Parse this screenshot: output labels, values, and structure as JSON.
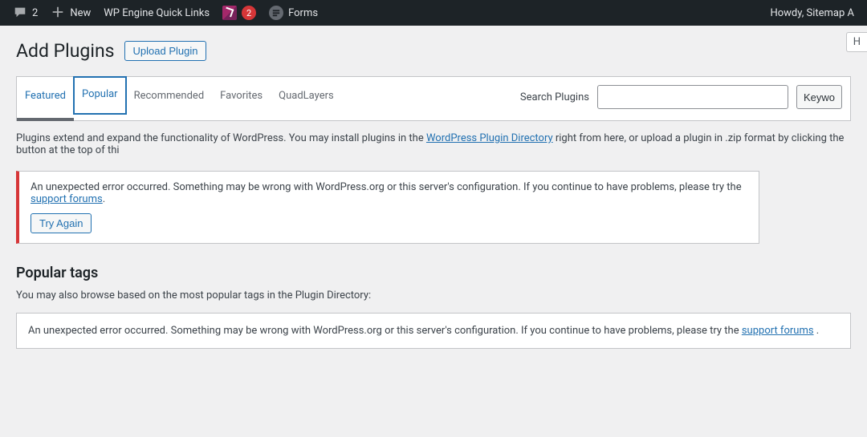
{
  "adminbar": {
    "comments_count": "2",
    "new_label": "New",
    "wpengine_label": "WP Engine Quick Links",
    "yoast_badge": "2",
    "forms_label": "Forms",
    "howdy": "Howdy, Sitemap A"
  },
  "help_tab": "H",
  "page": {
    "title": "Add Plugins",
    "upload_btn": "Upload Plugin"
  },
  "tabs": {
    "featured": "Featured",
    "popular": "Popular",
    "recommended": "Recommended",
    "favorites": "Favorites",
    "quadlayers": "QuadLayers"
  },
  "search": {
    "label": "Search Plugins",
    "keyword_btn": "Keywo"
  },
  "desc": {
    "pre": "Plugins extend and expand the functionality of WordPress. You may install plugins in the ",
    "link": "WordPress Plugin Directory",
    "post": " right from here, or upload a plugin in .zip format by clicking the button at the top of thi"
  },
  "error": {
    "msg_pre": "An unexpected error occurred. Something may be wrong with WordPress.org or this server's configuration. If you continue to have problems, please try the ",
    "support_link": "support forums",
    "period": ".",
    "try_again": "Try Again"
  },
  "popular_tags": {
    "heading": "Popular tags",
    "sub": "You may also browse based on the most popular tags in the Plugin Directory:"
  },
  "error2": {
    "msg_pre": "An unexpected error occurred. Something may be wrong with WordPress.org or this server's configuration. If you continue to have problems, please try the ",
    "support_link": "support forums",
    "post": " ."
  }
}
